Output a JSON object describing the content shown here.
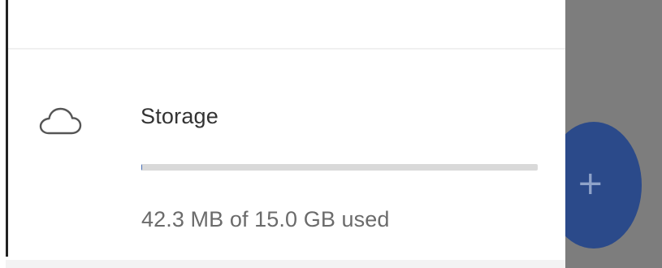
{
  "storage": {
    "title": "Storage",
    "usage_text": "42.3 MB of 15.0 GB used",
    "used_fraction": 0.003,
    "icon": "cloud-icon"
  },
  "fab": {
    "label": "+",
    "icon": "plus-icon"
  },
  "colors": {
    "scrim": "#7d7d7d",
    "fab": "#2b4a8a",
    "progress_track": "#d9d9d9"
  }
}
